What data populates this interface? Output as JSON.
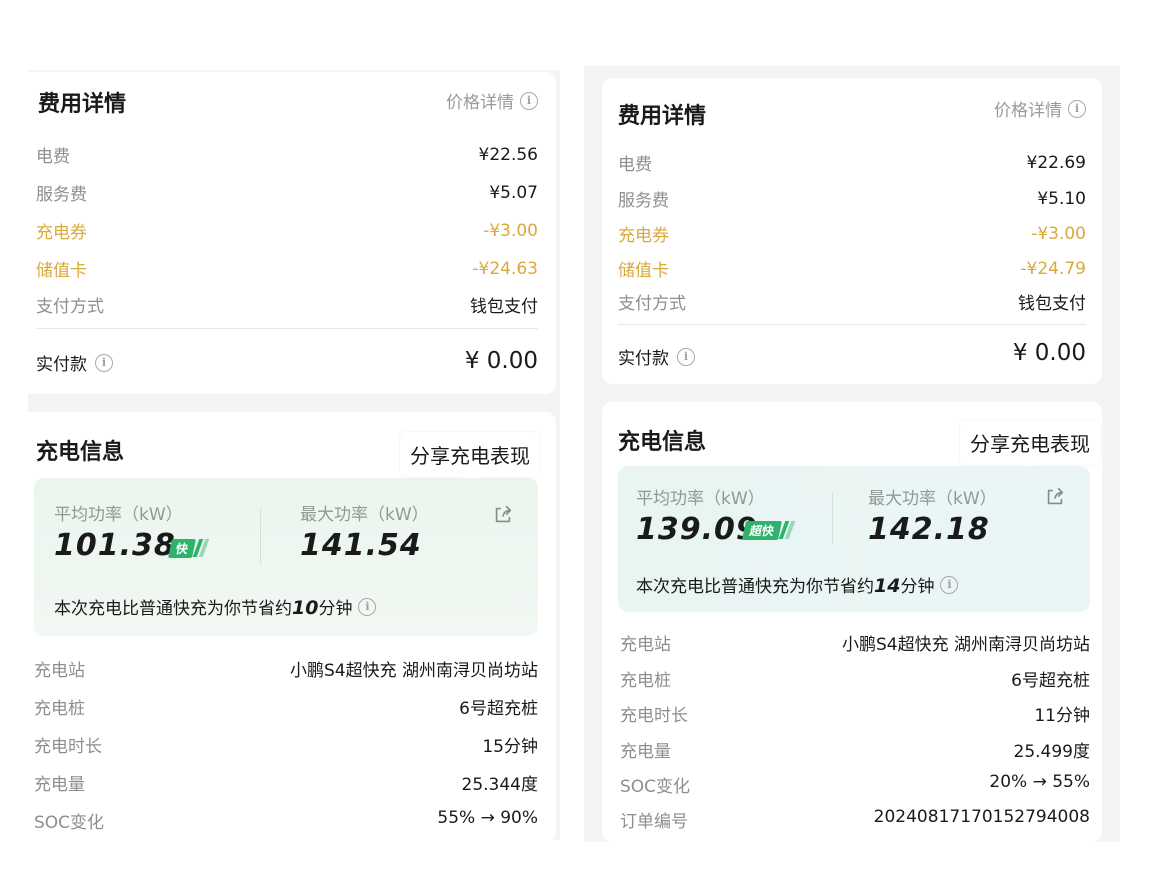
{
  "left": {
    "fee": {
      "title": "费用详情",
      "price_link": "价格详情",
      "rows": [
        {
          "label": "电费",
          "value": "¥22.56"
        },
        {
          "label": "服务费",
          "value": "¥5.07"
        },
        {
          "label": "充电券",
          "value": "-¥3.00"
        },
        {
          "label": "储值卡",
          "value": "-¥24.63"
        },
        {
          "label": "支付方式",
          "value": "钱包支付"
        }
      ],
      "paid_label": "实付款",
      "paid_value": "¥ 0.00"
    },
    "charge": {
      "title": "充电信息",
      "share_tip": "分享充电表现",
      "avg_label": "平均功率（kW）",
      "avg_value": "101.38",
      "badge": "快",
      "max_label": "最大功率（kW）",
      "max_value": "141.54",
      "note_prefix": "本次充电比普通快充为你节省约",
      "note_number": "10",
      "note_suffix": "分钟",
      "rows": [
        {
          "label": "充电站",
          "value": "小鹏S4超快充 湖州南浔贝尚坊站"
        },
        {
          "label": "充电桩",
          "value": "6号超充桩"
        },
        {
          "label": "充电时长",
          "value": "15分钟"
        },
        {
          "label": "充电量",
          "value": "25.344度"
        },
        {
          "label": "SOC变化",
          "value": "55% → 90%"
        }
      ]
    }
  },
  "right": {
    "fee": {
      "title": "费用详情",
      "price_link": "价格详情",
      "rows": [
        {
          "label": "电费",
          "value": "¥22.69"
        },
        {
          "label": "服务费",
          "value": "¥5.10"
        },
        {
          "label": "充电券",
          "value": "-¥3.00"
        },
        {
          "label": "储值卡",
          "value": "-¥24.79"
        },
        {
          "label": "支付方式",
          "value": "钱包支付"
        }
      ],
      "paid_label": "实付款",
      "paid_value": "¥ 0.00"
    },
    "charge": {
      "title": "充电信息",
      "share_tip": "分享充电表现",
      "avg_label": "平均功率（kW）",
      "avg_value": "139.09",
      "badge": "超快",
      "max_label": "最大功率（kW）",
      "max_value": "142.18",
      "note_prefix": "本次充电比普通快充为你节省约",
      "note_number": "14",
      "note_suffix": "分钟",
      "rows": [
        {
          "label": "充电站",
          "value": "小鹏S4超快充 湖州南浔贝尚坊站"
        },
        {
          "label": "充电桩",
          "value": "6号超充桩"
        },
        {
          "label": "充电时长",
          "value": "11分钟"
        },
        {
          "label": "充电量",
          "value": "25.499度"
        },
        {
          "label": "SOC变化",
          "value": "20% → 55%"
        },
        {
          "label": "订单编号",
          "value": "20240817170152794008"
        }
      ]
    }
  },
  "icons": {
    "info": "info-circle-icon",
    "share": "share-icon"
  },
  "colors": {
    "gold": "#d9a93a",
    "green": "#2fb36b",
    "label_gray": "#8e8e8e"
  }
}
